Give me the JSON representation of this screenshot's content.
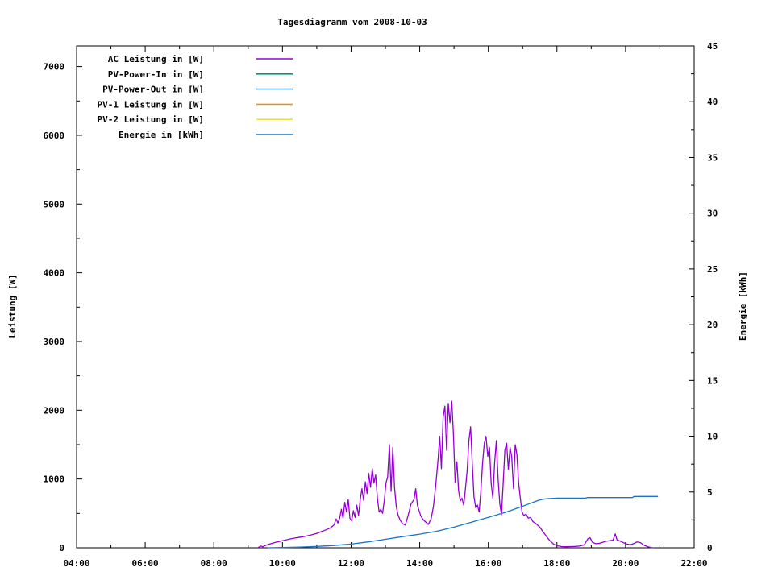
{
  "chart_data": {
    "type": "line",
    "title": "Tagesdiagramm vom 2008-10-03",
    "background": "#ffffff",
    "axis_color": "#000000",
    "legend_position": "top-left-inside",
    "grid": false,
    "x_axis": {
      "start_min": 240,
      "end_min": 1320,
      "major_step_min": 120,
      "minor_step_min": 60,
      "labels": [
        "04:00",
        "06:00",
        "08:00",
        "10:00",
        "12:00",
        "14:00",
        "16:00",
        "18:00",
        "20:00",
        "22:00"
      ]
    },
    "y_axis": {
      "label": "Leistung [W]",
      "min": 0,
      "max": 7300,
      "major_step": 1000,
      "minor_step": 500,
      "tick_labels": [
        "0",
        "1000",
        "2000",
        "3000",
        "4000",
        "5000",
        "6000",
        "7000"
      ]
    },
    "y2_axis": {
      "label": "Energie [kWh]",
      "min": 0,
      "max": 45,
      "major_step": 5,
      "minor_step": 2.5,
      "tick_labels": [
        "0",
        "5",
        "10",
        "15",
        "20",
        "25",
        "30",
        "35",
        "40",
        "45"
      ]
    },
    "series": [
      {
        "name": "AC Leistung in [W]",
        "color": "#9400D3",
        "axis": "left",
        "visible_in_plot": true,
        "points": [
          [
            558,
            5
          ],
          [
            562,
            25
          ],
          [
            566,
            15
          ],
          [
            572,
            40
          ],
          [
            580,
            60
          ],
          [
            588,
            80
          ],
          [
            596,
            95
          ],
          [
            604,
            110
          ],
          [
            612,
            125
          ],
          [
            620,
            140
          ],
          [
            628,
            150
          ],
          [
            636,
            160
          ],
          [
            644,
            175
          ],
          [
            652,
            190
          ],
          [
            660,
            210
          ],
          [
            668,
            235
          ],
          [
            676,
            260
          ],
          [
            684,
            290
          ],
          [
            690,
            330
          ],
          [
            694,
            420
          ],
          [
            697,
            360
          ],
          [
            700,
            430
          ],
          [
            703,
            560
          ],
          [
            706,
            430
          ],
          [
            709,
            660
          ],
          [
            712,
            520
          ],
          [
            715,
            700
          ],
          [
            718,
            430
          ],
          [
            721,
            390
          ],
          [
            724,
            540
          ],
          [
            727,
            440
          ],
          [
            730,
            620
          ],
          [
            733,
            470
          ],
          [
            736,
            700
          ],
          [
            739,
            860
          ],
          [
            742,
            690
          ],
          [
            745,
            960
          ],
          [
            748,
            790
          ],
          [
            751,
            1080
          ],
          [
            754,
            880
          ],
          [
            757,
            1150
          ],
          [
            760,
            940
          ],
          [
            763,
            1060
          ],
          [
            766,
            720
          ],
          [
            769,
            520
          ],
          [
            772,
            560
          ],
          [
            775,
            500
          ],
          [
            778,
            680
          ],
          [
            781,
            940
          ],
          [
            784,
            1030
          ],
          [
            787,
            1500
          ],
          [
            790,
            820
          ],
          [
            793,
            1460
          ],
          [
            796,
            880
          ],
          [
            799,
            600
          ],
          [
            802,
            480
          ],
          [
            806,
            400
          ],
          [
            810,
            350
          ],
          [
            815,
            330
          ],
          [
            820,
            480
          ],
          [
            825,
            640
          ],
          [
            830,
            700
          ],
          [
            833,
            860
          ],
          [
            836,
            620
          ],
          [
            839,
            540
          ],
          [
            842,
            460
          ],
          [
            846,
            410
          ],
          [
            850,
            380
          ],
          [
            855,
            340
          ],
          [
            860,
            420
          ],
          [
            864,
            600
          ],
          [
            868,
            900
          ],
          [
            872,
            1280
          ],
          [
            875,
            1620
          ],
          [
            878,
            1150
          ],
          [
            881,
            1900
          ],
          [
            884,
            2060
          ],
          [
            887,
            1420
          ],
          [
            890,
            2100
          ],
          [
            893,
            1820
          ],
          [
            896,
            2130
          ],
          [
            899,
            1650
          ],
          [
            902,
            950
          ],
          [
            905,
            1250
          ],
          [
            908,
            830
          ],
          [
            911,
            680
          ],
          [
            914,
            720
          ],
          [
            917,
            620
          ],
          [
            920,
            860
          ],
          [
            923,
            1120
          ],
          [
            926,
            1560
          ],
          [
            929,
            1760
          ],
          [
            932,
            1220
          ],
          [
            935,
            740
          ],
          [
            938,
            580
          ],
          [
            941,
            620
          ],
          [
            944,
            520
          ],
          [
            947,
            820
          ],
          [
            950,
            1240
          ],
          [
            953,
            1520
          ],
          [
            956,
            1620
          ],
          [
            959,
            1330
          ],
          [
            962,
            1460
          ],
          [
            965,
            940
          ],
          [
            968,
            720
          ],
          [
            971,
            1240
          ],
          [
            974,
            1560
          ],
          [
            977,
            1020
          ],
          [
            980,
            640
          ],
          [
            983,
            480
          ],
          [
            986,
            940
          ],
          [
            989,
            1420
          ],
          [
            992,
            1520
          ],
          [
            995,
            1140
          ],
          [
            998,
            1460
          ],
          [
            1001,
            1320
          ],
          [
            1004,
            860
          ],
          [
            1007,
            1500
          ],
          [
            1010,
            1360
          ],
          [
            1013,
            940
          ],
          [
            1016,
            720
          ],
          [
            1019,
            520
          ],
          [
            1022,
            470
          ],
          [
            1026,
            490
          ],
          [
            1030,
            430
          ],
          [
            1034,
            440
          ],
          [
            1038,
            380
          ],
          [
            1042,
            360
          ],
          [
            1046,
            330
          ],
          [
            1050,
            300
          ],
          [
            1056,
            230
          ],
          [
            1062,
            160
          ],
          [
            1068,
            100
          ],
          [
            1074,
            55
          ],
          [
            1080,
            30
          ],
          [
            1088,
            18
          ],
          [
            1096,
            15
          ],
          [
            1104,
            18
          ],
          [
            1112,
            20
          ],
          [
            1120,
            25
          ],
          [
            1128,
            45
          ],
          [
            1134,
            130
          ],
          [
            1138,
            145
          ],
          [
            1142,
            80
          ],
          [
            1148,
            60
          ],
          [
            1154,
            65
          ],
          [
            1160,
            80
          ],
          [
            1166,
            95
          ],
          [
            1170,
            100
          ],
          [
            1174,
            105
          ],
          [
            1178,
            110
          ],
          [
            1182,
            200
          ],
          [
            1185,
            115
          ],
          [
            1190,
            100
          ],
          [
            1196,
            75
          ],
          [
            1202,
            55
          ],
          [
            1208,
            45
          ],
          [
            1214,
            60
          ],
          [
            1220,
            85
          ],
          [
            1226,
            75
          ],
          [
            1232,
            40
          ],
          [
            1238,
            18
          ],
          [
            1244,
            5
          ],
          [
            1248,
            0
          ]
        ]
      },
      {
        "name": "PV-Power-In in [W]",
        "color": "#009688",
        "axis": "left",
        "visible_in_plot": false,
        "points": []
      },
      {
        "name": "PV-Power-Out in [W]",
        "color": "#58A8E8",
        "axis": "left",
        "visible_in_plot": false,
        "points": []
      },
      {
        "name": "PV-1 Leistung in [W]",
        "color": "#DF9B13",
        "axis": "left",
        "visible_in_plot": false,
        "points": []
      },
      {
        "name": "PV-2 Leistung in [W]",
        "color": "#EEE24E",
        "axis": "left",
        "visible_in_plot": false,
        "points": []
      },
      {
        "name": "Energie in [kWh]",
        "color": "#1874CD",
        "axis": "right",
        "visible_in_plot": true,
        "points": [
          [
            575,
            0
          ],
          [
            600,
            0.02
          ],
          [
            630,
            0.06
          ],
          [
            660,
            0.12
          ],
          [
            690,
            0.2
          ],
          [
            720,
            0.33
          ],
          [
            750,
            0.53
          ],
          [
            780,
            0.76
          ],
          [
            810,
            1.0
          ],
          [
            840,
            1.22
          ],
          [
            870,
            1.48
          ],
          [
            900,
            1.85
          ],
          [
            930,
            2.28
          ],
          [
            960,
            2.72
          ],
          [
            990,
            3.18
          ],
          [
            1008,
            3.5
          ],
          [
            1020,
            3.72
          ],
          [
            1032,
            3.95
          ],
          [
            1044,
            4.18
          ],
          [
            1050,
            4.28
          ],
          [
            1056,
            4.35
          ],
          [
            1062,
            4.4
          ],
          [
            1080,
            4.45
          ],
          [
            1130,
            4.45
          ],
          [
            1133,
            4.5
          ],
          [
            1212,
            4.5
          ],
          [
            1215,
            4.6
          ],
          [
            1256,
            4.6
          ]
        ]
      }
    ]
  }
}
